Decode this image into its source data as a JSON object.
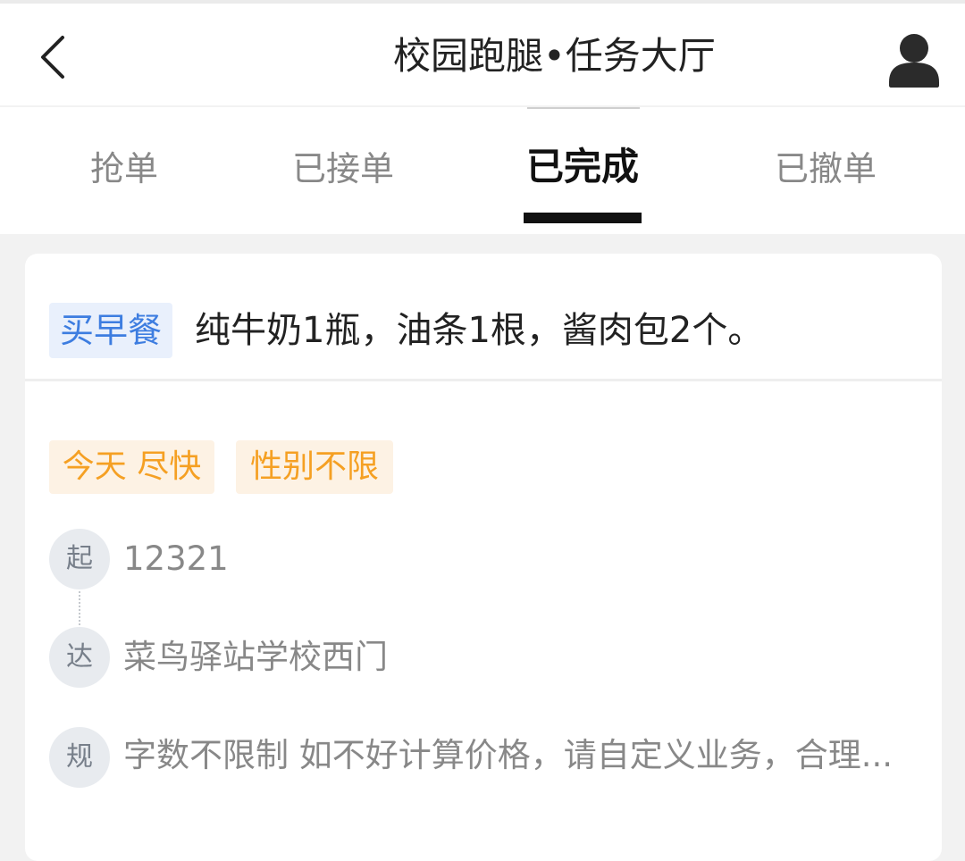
{
  "header": {
    "title": "校园跑腿•任务大厅",
    "back_icon": "chevron-left-icon",
    "user_icon": "user-avatar-icon"
  },
  "tabs": [
    {
      "label": "抢单",
      "active": false
    },
    {
      "label": "已接单",
      "active": false
    },
    {
      "label": "已完成",
      "active": true
    },
    {
      "label": "已撤单",
      "active": false
    }
  ],
  "task": {
    "category": "买早餐",
    "description": "纯牛奶1瓶，油条1根，酱肉包2个。",
    "badges": {
      "time": "今天 尽快",
      "gender": "性别不限"
    },
    "start": {
      "marker": "起",
      "text": "12321"
    },
    "end": {
      "marker": "达",
      "text": "菜鸟驿站学校西门"
    },
    "rule": {
      "marker": "规",
      "text": "字数不限制  如不好计算价格，请自定义业务，合理..."
    }
  },
  "colors": {
    "accent_blue": "#3d7de0",
    "tag_blue_bg": "#e9f0fc",
    "accent_orange": "#f5a023",
    "tag_orange_bg": "#fdf2e4",
    "active_tab": "#111111",
    "inactive_tab": "#888888"
  }
}
